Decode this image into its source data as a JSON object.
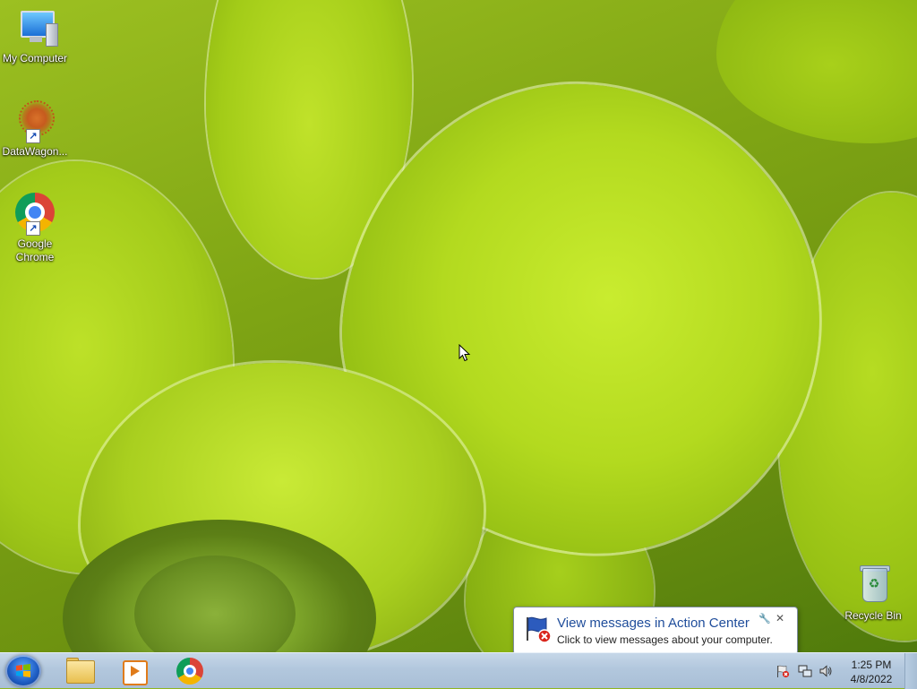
{
  "desktop": {
    "icons": [
      {
        "label": "My Computer",
        "icon": "computer-icon"
      },
      {
        "label": "DataWagon...",
        "icon": "datawagon-icon",
        "shortcut": true
      },
      {
        "label": "Google Chrome",
        "icon": "chrome-icon",
        "shortcut": true
      },
      {
        "label": "Recycle Bin",
        "icon": "recycle-bin-icon"
      }
    ]
  },
  "notification": {
    "title": "View messages in Action Center",
    "text": "Click to view messages about your computer.",
    "icon": "action-center-flag-icon",
    "close_glyph": "✕"
  },
  "taskbar": {
    "start_icon": "windows-start-icon",
    "pinned": [
      {
        "name": "Windows Explorer",
        "icon": "folder-icon"
      },
      {
        "name": "Windows Media Player",
        "icon": "media-player-icon"
      },
      {
        "name": "Google Chrome",
        "icon": "chrome-icon"
      }
    ],
    "tray": {
      "icons": [
        "action-center-flag-icon",
        "network-icon",
        "volume-icon"
      ],
      "time": "1:25 PM",
      "date": "4/8/2022"
    }
  },
  "colors": {
    "taskbar": "#b2c7dd",
    "notification_title": "#1f4d9b",
    "wallpaper_green": "#a9cf1f"
  }
}
